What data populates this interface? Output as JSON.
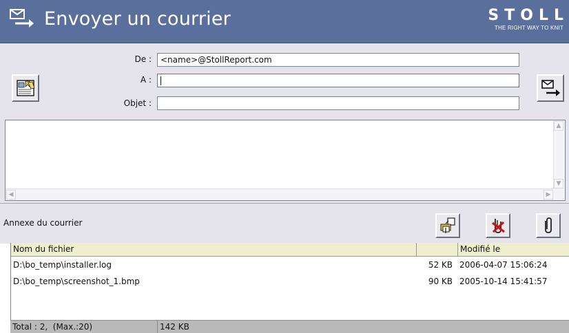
{
  "window": {
    "title": "Envoyer un courrier",
    "title_icon": "send-mail-icon",
    "brand_name": "STOLL",
    "brand_tagline": "THE RIGHT WAY TO KNIT",
    "bar_color": "#5a6f9b"
  },
  "form": {
    "from_label": "De :",
    "from_value": "<name>@StollReport.com",
    "to_label": "A :",
    "to_value": "",
    "subject_label": "Objet :",
    "subject_value": "",
    "address_book_icon": "address-book-icon",
    "send_icon": "send-mail-icon"
  },
  "message": {
    "body": ""
  },
  "attachments": {
    "label": "Annexe du courrier",
    "buttons": [
      {
        "icon": "add-attachment-icon"
      },
      {
        "icon": "delete-attachment-icon"
      },
      {
        "icon": "paperclip-icon"
      }
    ],
    "columns": [
      "Nom du fichier",
      "",
      "Modifié le"
    ],
    "rows": [
      {
        "name": "D:\\bo_temp\\installer.log",
        "size": "52 KB",
        "modified": "2006-04-07 15:06:24"
      },
      {
        "name": "D:\\bo_temp\\screenshot_1.bmp",
        "size": "90 KB",
        "modified": "2005-10-14 15:41:57"
      }
    ],
    "status_total": "Total : 2,  (Max.:20)",
    "status_size": "142 KB"
  },
  "colors": {
    "title_bar": "#5a6f9b",
    "panel": "#e4e4ea",
    "list_header": "#efefcf",
    "status_bar": "#b9b9b9",
    "delete_accent": "#cc1111"
  }
}
